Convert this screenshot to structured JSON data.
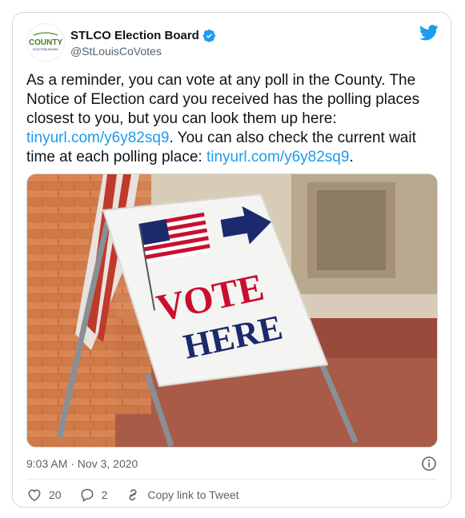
{
  "account": {
    "avatar_text_top": "COUNTY",
    "avatar_text_bottom": "ELECTION BOARD",
    "display_name": "STLCO Election Board",
    "handle": "@StLouisCoVotes",
    "verified_icon": "verified-badge-icon"
  },
  "tweet": {
    "text_part1": "As a reminder, you can vote at any poll in the County. The Notice of Election card you received has the polling places closest to you, but you can look them up here: ",
    "link1": "tinyurl.com/y6y82sq9",
    "text_part2": ". You can also check the current wait time at each polling place: ",
    "link2": "tinyurl.com/y6y82sq9",
    "text_part3": "."
  },
  "media": {
    "sign_line1": "VOTE",
    "sign_line2": "HERE"
  },
  "meta": {
    "timestamp": "9:03 AM · Nov 3, 2020"
  },
  "actions": {
    "likes": "20",
    "replies": "2",
    "copy_link": "Copy link to Tweet"
  },
  "colors": {
    "link": "#1d9bf0",
    "twitter_blue": "#1d9bf0",
    "sign_red": "#c8102e",
    "sign_blue": "#1a2a6c"
  }
}
